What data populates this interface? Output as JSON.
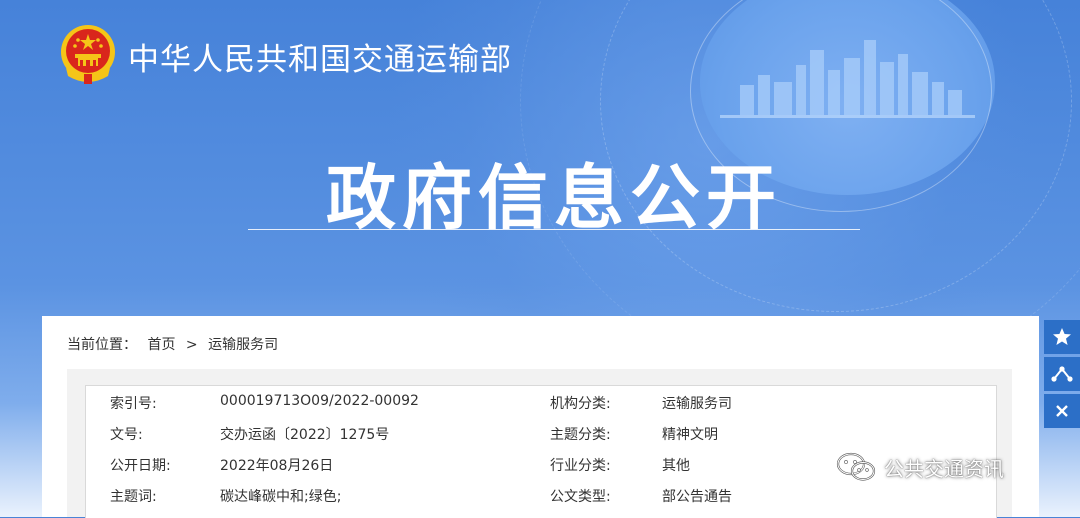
{
  "header": {
    "site_title": "中华人民共和国交通运输部",
    "banner_title": "政府信息公开"
  },
  "breadcrumb": {
    "prefix": "当前位置：",
    "home": "首页",
    "separator": ">",
    "current": "运输服务司"
  },
  "info": {
    "rows": [
      {
        "label1": "索引号:",
        "value1": "000019713O09/2022-00092",
        "label2": "机构分类:",
        "value2": "运输服务司"
      },
      {
        "label1": "文号:",
        "value1": "交办运函〔2022〕1275号",
        "label2": "主题分类:",
        "value2": "精神文明"
      },
      {
        "label1": "公开日期:",
        "value1": "2022年08月26日",
        "label2": "行业分类:",
        "value2": "其他"
      },
      {
        "label1": "主题词:",
        "value1": "碳达峰碳中和;绿色;",
        "label2": "公文类型:",
        "value2": "部公告通告"
      }
    ]
  },
  "side_buttons": [
    {
      "icon": "star-icon"
    },
    {
      "icon": "share-icon"
    },
    {
      "icon": "close-icon"
    }
  ],
  "watermark": {
    "text": "公共交通资讯",
    "icon": "wechat-icon"
  },
  "colors": {
    "banner_blue": "#4682d9",
    "side_button": "#2c6fc7",
    "emblem_red": "#d9261c",
    "emblem_gold": "#f5c518"
  }
}
